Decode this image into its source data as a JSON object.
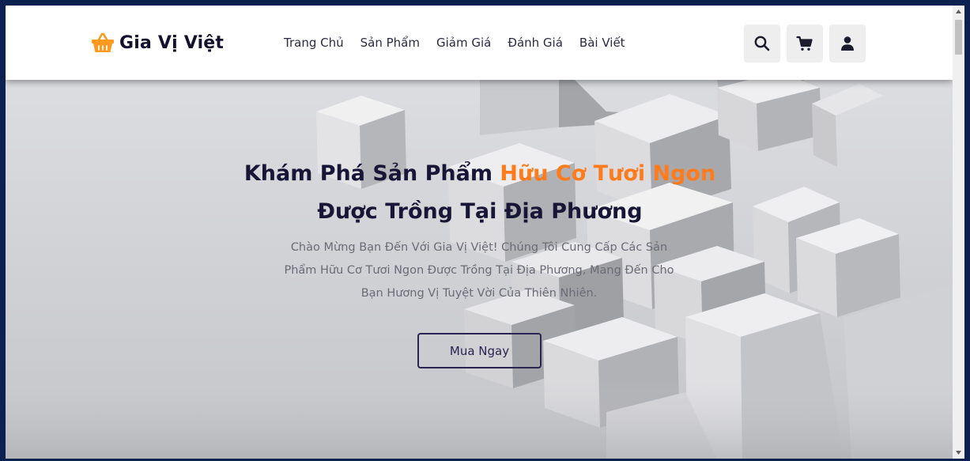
{
  "brand": {
    "name": "Gia Vị Việt",
    "icon": "shopping-basket-icon",
    "icon_color": "#ff9a1e"
  },
  "nav": {
    "links": [
      "Trang Chủ",
      "Sản Phẩm",
      "Giảm Giá",
      "Đánh Giá",
      "Bài Viết"
    ],
    "icons": [
      "search-icon",
      "cart-icon",
      "user-icon"
    ]
  },
  "hero": {
    "title_part1": "Khám Phá Sản Phẩm",
    "title_highlight": "Hữu Cơ Tươi Ngon",
    "title_part2": "Được Trồng Tại Địa Phương",
    "description_line1": "Chào Mừng Bạn Đến Với Gia Vị Việt! Chúng Tôi Cung Cấp Các Sản",
    "description_line2": "Phẩm Hữu Cơ Tươi Ngon Được Trồng Tại Địa Phương, Mang Đến Cho",
    "description_line3": "Bạn Hương Vị Tuyệt Vời Của Thiên Nhiên.",
    "button_label": "Mua Ngay"
  },
  "colors": {
    "accent": "#ff7b1c",
    "title": "#171637",
    "frame": "#0d2150",
    "button_border": "#2a2353"
  }
}
